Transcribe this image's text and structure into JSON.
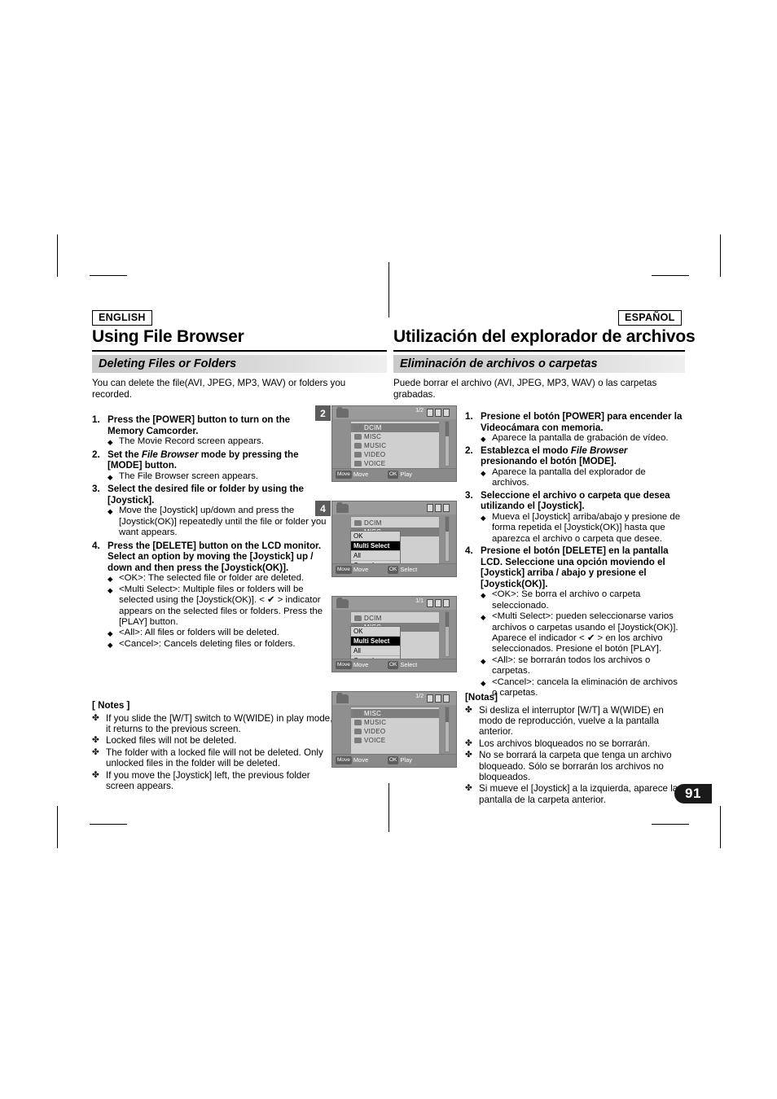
{
  "page": {
    "number": "91"
  },
  "left": {
    "lang": "ENGLISH",
    "title": "Using File Browser",
    "subhead": "Deleting Files or Folders",
    "intro": "You can delete the file(AVI, JPEG, MP3, WAV) or folders you recorded.",
    "steps": [
      {
        "num": "1.",
        "text_parts": [
          "Press the [POWER] button to turn on the Memory Camcorder."
        ],
        "bullets": [
          "The Movie Record screen appears."
        ]
      },
      {
        "num": "2.",
        "text_pre": "Set the ",
        "text_ital": "File Browser",
        "text_post": " mode by pressing the [MODE] button.",
        "bullets": [
          "The File Browser screen appears."
        ]
      },
      {
        "num": "3.",
        "text_parts": [
          "Select the desired file or folder by using the [Joystick]."
        ],
        "bullets": [
          "Move the [Joystick] up/down and press the [Joystick(OK)] repeatedly until the file or folder you want appears."
        ]
      },
      {
        "num": "4.",
        "text_parts": [
          "Press the [DELETE] button on the LCD monitor. Select an option by moving the [Joystick] up / down and then press the [Joystick(OK)]."
        ],
        "bullets": [
          "<OK>: The selected file or folder are deleted.",
          "<Multi Select>: Multiple files or folders will be selected using the [Joystick(OK)]. < ✔ > indicator appears on the selected files or folders. Press the [PLAY] button.",
          "<All>: All files or folders will be deleted.",
          "<Cancel>: Cancels deleting files or folders."
        ]
      }
    ],
    "notes_title": "[ Notes ]",
    "notes": [
      "If you slide the [W/T] switch to W(WIDE) in play mode, it returns to the previous screen.",
      "Locked files will not be deleted.",
      "The folder with a locked file will not be deleted. Only unlocked files in the folder will be deleted.",
      "If you move the [Joystick] left, the previous folder screen appears."
    ]
  },
  "right": {
    "lang": "ESPAÑOL",
    "title": "Utilización del explorador de archivos",
    "subhead": "Eliminación de archivos o carpetas",
    "intro": "Puede borrar el archivo (AVI, JPEG, MP3, WAV) o las carpetas grabadas.",
    "steps": [
      {
        "num": "1.",
        "text_parts": [
          "Presione el botón [POWER] para encender la Videocámara con memoria."
        ],
        "bullets": [
          "Aparece la pantalla de grabación de vídeo."
        ]
      },
      {
        "num": "2.",
        "text_pre": "Establezca el modo ",
        "text_ital": "File Browser",
        "text_post": " presionando el botón [MODE].",
        "bullets": [
          "Aparece la pantalla del explorador de archivos."
        ]
      },
      {
        "num": "3.",
        "text_parts": [
          "Seleccione el archivo o carpeta que desea utilizando el [Joystick]."
        ],
        "bullets": [
          "Mueva el [Joystick] arriba/abajo y presione de forma repetida el [Joystick(OK)] hasta que aparezca el archivo o carpeta que desee."
        ]
      },
      {
        "num": "4.",
        "text_parts": [
          "Presione el botón [DELETE] en la pantalla LCD. Seleccione una opción moviendo el [Joystick] arriba / abajo y presione el [Joystick(OK)]."
        ],
        "bullets": [
          "<OK>: Se borra el archivo o carpeta seleccionado.",
          "<Multi Select>: pueden seleccionarse varios archivos o carpetas usando el [Joystick(OK)]. Aparece el indicador < ✔ > en los archivo seleccionados. Presione el botón [PLAY].",
          "<All>: se borrarán todos los archivos o carpetas.",
          "<Cancel>: cancela la eliminación de archivos o carpetas."
        ]
      }
    ],
    "notes_title": "[Notas]",
    "notes": [
      "Si desliza el interruptor [W/T] a W(WIDE) en modo de reproducción, vuelve a la pantalla anterior.",
      "Los archivos bloqueados no se borrarán.",
      "No se borrará la carpeta que tenga un archivo bloqueado. Sólo se borrarán los archivos no bloqueados.",
      "Si mueve el [Joystick] a la izquierda, aparece la pantalla de la carpeta anterior."
    ]
  },
  "screens": [
    {
      "badge": "2",
      "page_indicator": "1/2",
      "rows": [
        {
          "label": "DCIM",
          "selected": true
        },
        {
          "label": "MISC",
          "selected": false
        },
        {
          "label": "MUSIC",
          "selected": false
        },
        {
          "label": "VIDEO",
          "selected": false
        },
        {
          "label": "VOICE",
          "selected": false
        }
      ],
      "bottom_left_key": "Move",
      "bottom_left_label": "Move",
      "bottom_right_key": "OK",
      "bottom_right_label": "Play"
    },
    {
      "badge": "4",
      "page_indicator": "",
      "rows": [
        {
          "label": "DCIM",
          "selected": false
        },
        {
          "label": "MISC",
          "selected": true
        }
      ],
      "menu": [
        "OK",
        "Multi Select",
        "All",
        "Cancel"
      ],
      "menu_selected_index": 1,
      "bottom_left_key": "Move",
      "bottom_left_label": "Move",
      "bottom_right_key": "OK",
      "bottom_right_label": "Select"
    },
    {
      "badge": "",
      "page_indicator": "1/1",
      "rows": [
        {
          "label": "DCIM",
          "selected": false
        },
        {
          "label": "MISC",
          "selected": true
        }
      ],
      "menu": [
        "OK",
        "Multi Select",
        "All",
        "Cancel"
      ],
      "menu_selected_index": 1,
      "bottom_left_key": "Move",
      "bottom_left_label": "Move",
      "bottom_right_key": "OK",
      "bottom_right_label": "Select"
    },
    {
      "badge": "",
      "page_indicator": "1/2",
      "rows": [
        {
          "label": "MISC",
          "selected": true
        },
        {
          "label": "MUSIC",
          "selected": false
        },
        {
          "label": "VIDEO",
          "selected": false
        },
        {
          "label": "VOICE",
          "selected": false
        }
      ],
      "bottom_left_key": "Move",
      "bottom_left_label": "Move",
      "bottom_right_key": "OK",
      "bottom_right_label": "Play"
    }
  ]
}
